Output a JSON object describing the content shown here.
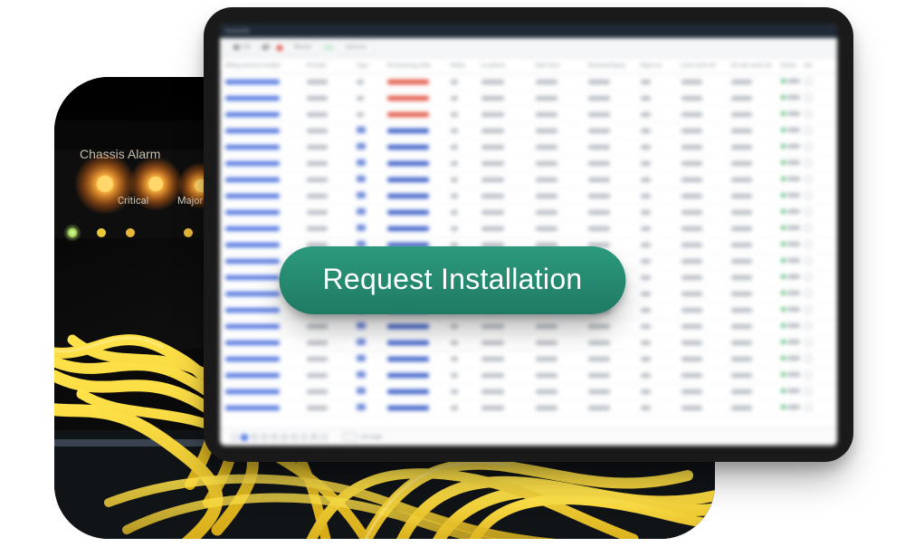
{
  "cta_label": "Request Installation",
  "photo": {
    "chassis_label": "Chassis Alarm",
    "led_labels": [
      "Critical",
      "Major"
    ]
  },
  "app": {
    "menubar_title": "Accounts",
    "toolbar": {
      "selected_count": "48",
      "selected_unit": "(00)",
      "badge1": "87",
      "pill_text_a": "filtered",
      "pill_text_b": "columns",
      "clear": "×"
    },
    "columns": [
      "Billing account number",
      "Provider",
      "Type",
      "Provisioning state",
      "Notes",
      "Locations",
      "Start term",
      "Renewal/Expiry",
      "Rate/mo",
      "Cost cents US",
      "Alt rate cents US",
      "Status",
      "Sel"
    ],
    "footer": {
      "pages": [
        "1",
        "2",
        "3",
        "4",
        "5",
        "6",
        "7",
        "8"
      ],
      "active_page_index": 0,
      "per_page_label": "per page"
    },
    "row_kinds": [
      "red",
      "red",
      "red",
      "tag",
      "tag",
      "tag",
      "tag",
      "tag",
      "tag",
      "tag",
      "tag",
      "tag",
      "tag",
      "tag",
      "tag",
      "tag",
      "tag",
      "tag",
      "tag",
      "tag",
      "tag"
    ]
  }
}
